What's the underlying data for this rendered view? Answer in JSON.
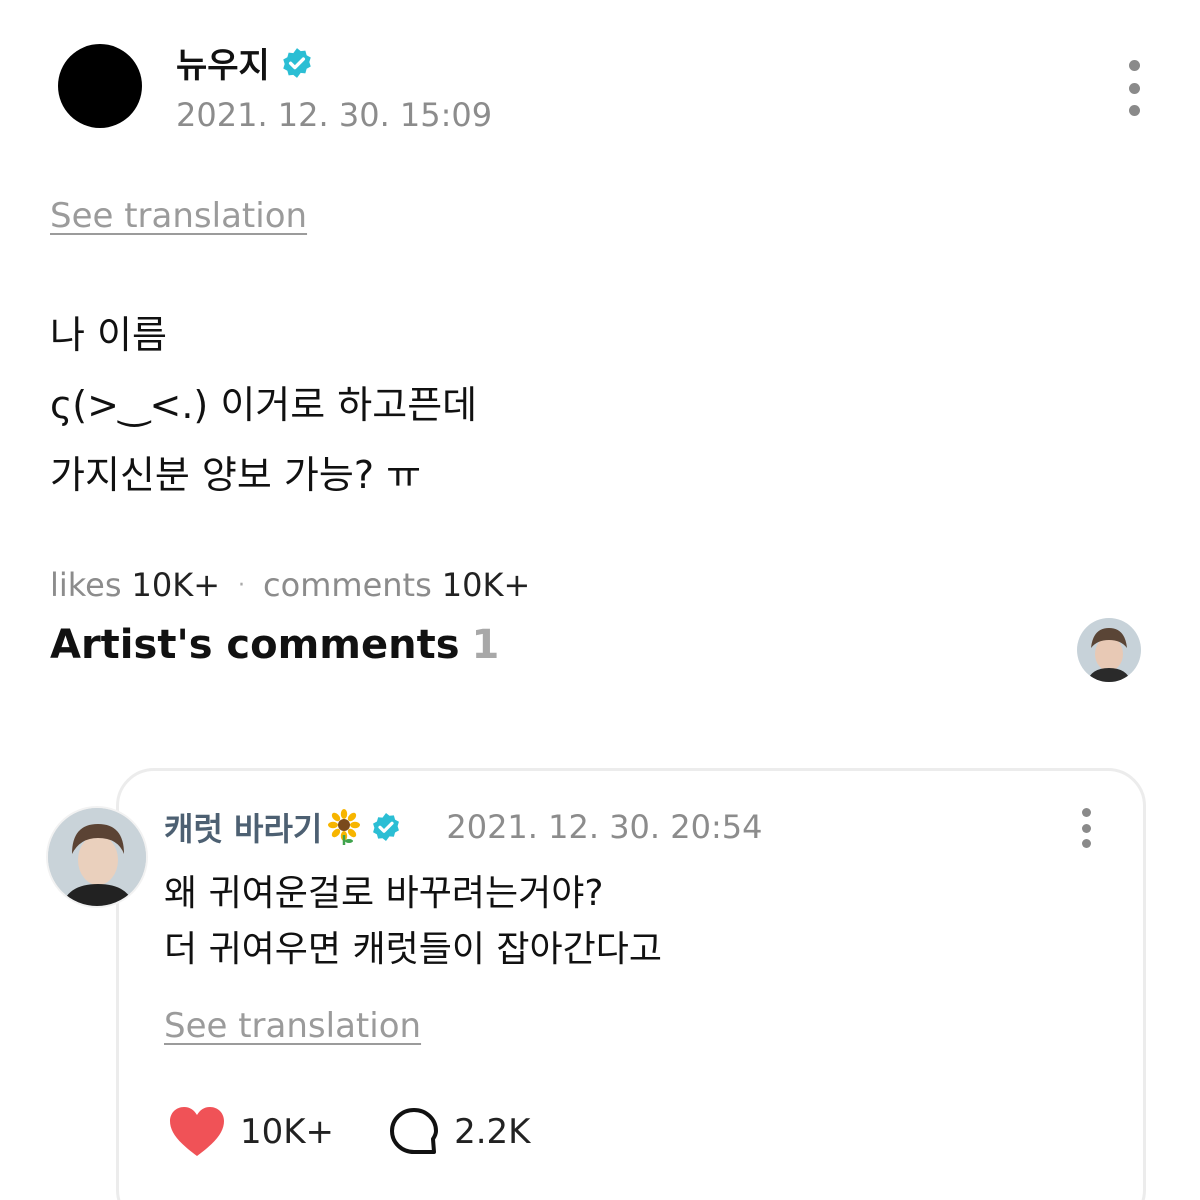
{
  "post": {
    "author": "뉴우지",
    "date": "2021. 12. 30. 15:09",
    "see_translation": "See translation",
    "lines": [
      "나 이름",
      "ς(>‿<.) 이거로 하고픈데",
      "가지신분 양보 가능? ㅠ"
    ],
    "icons": {
      "avatar": "avatar",
      "verified": "verified-badge-icon",
      "more": "more-vertical-icon"
    }
  },
  "stats": {
    "likes_label": "likes",
    "likes_value": "10K+",
    "separator": "·",
    "comments_label": "comments",
    "comments_value": "10K+"
  },
  "artist_comments": {
    "title": "Artist's comments",
    "count": "1"
  },
  "comment": {
    "author": "캐럿 바라기",
    "date": "2021. 12. 30. 20:54",
    "lines": [
      "왜 귀여운걸로 바꾸려는거야?",
      "더 귀여우면 캐럿들이 잡아간다고"
    ],
    "see_translation": "See translation",
    "likes": "10K+",
    "replies": "2.2K",
    "icons": {
      "sunflower": "sunflower-emoji-icon",
      "verified": "verified-badge-icon",
      "heart": "heart-icon",
      "reply": "speech-bubble-icon",
      "more": "more-vertical-icon"
    }
  },
  "colors": {
    "verified": "#2bbed4",
    "heart": "#f05257",
    "comment_author": "#4d6072",
    "muted": "#8c8c8c"
  }
}
